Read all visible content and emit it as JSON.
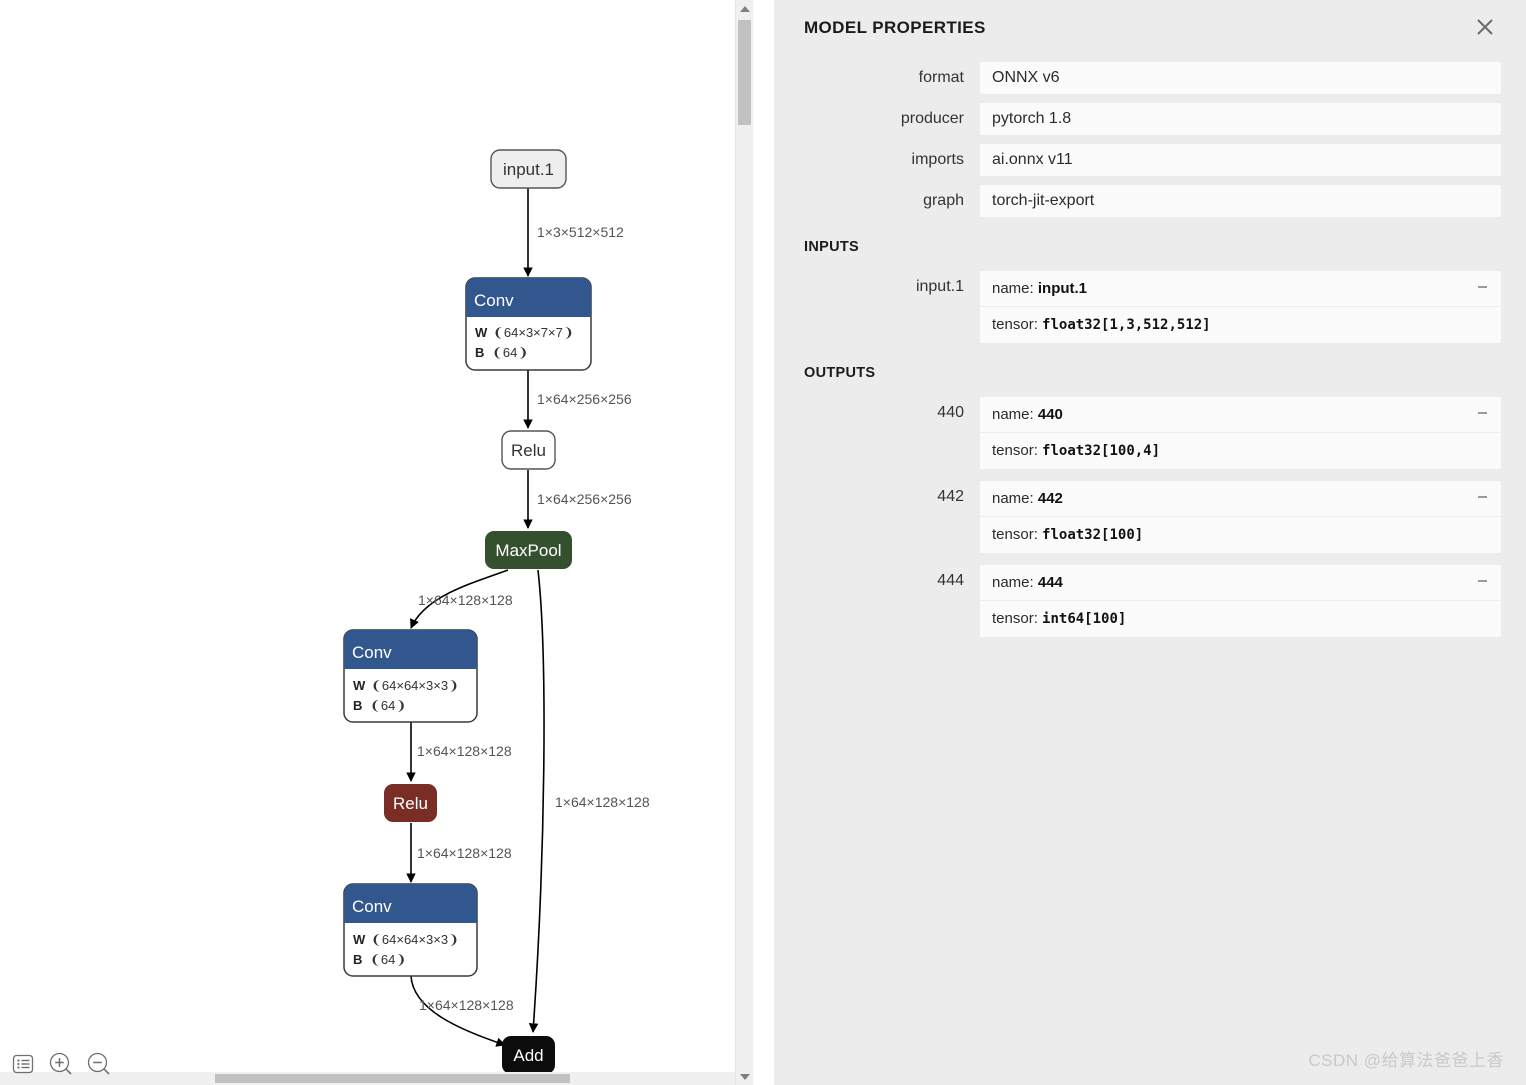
{
  "panel": {
    "title": "MODEL PROPERTIES",
    "close_icon": "close-icon",
    "fields": [
      {
        "label": "format",
        "value": "ONNX v6"
      },
      {
        "label": "producer",
        "value": "pytorch 1.8"
      },
      {
        "label": "imports",
        "value": "ai.onnx v11"
      },
      {
        "label": "graph",
        "value": "torch-jit-export"
      }
    ],
    "inputs_title": "INPUTS",
    "inputs": [
      {
        "label": "input.1",
        "name_prefix": "name: ",
        "name_value": "input.1",
        "tensor_prefix": "tensor: ",
        "tensor_value": "float32[1,3,512,512]"
      }
    ],
    "outputs_title": "OUTPUTS",
    "outputs": [
      {
        "label": "440",
        "name_prefix": "name: ",
        "name_value": "440",
        "tensor_prefix": "tensor: ",
        "tensor_value": "float32[100,4]"
      },
      {
        "label": "442",
        "name_prefix": "name: ",
        "name_value": "442",
        "tensor_prefix": "tensor: ",
        "tensor_value": "float32[100]"
      },
      {
        "label": "444",
        "name_prefix": "name: ",
        "name_value": "444",
        "tensor_prefix": "tensor: ",
        "tensor_value": "int64[100]"
      }
    ]
  },
  "graph": {
    "nodes": {
      "input1": {
        "label": "input.1",
        "type": "io"
      },
      "conv1": {
        "label": "Conv",
        "type": "op",
        "color": "#32578f",
        "attrs": [
          {
            "key": "W",
            "value": "❨64×3×7×7❩"
          },
          {
            "key": "B",
            "value": "❨64❩"
          }
        ]
      },
      "relu1": {
        "label": "Relu",
        "type": "plain"
      },
      "maxpool": {
        "label": "MaxPool",
        "type": "op-simple",
        "color": "#34502f"
      },
      "conv2": {
        "label": "Conv",
        "type": "op",
        "color": "#32578f",
        "attrs": [
          {
            "key": "W",
            "value": "❨64×64×3×3❩"
          },
          {
            "key": "B",
            "value": "❨64❩"
          }
        ]
      },
      "relu2": {
        "label": "Relu",
        "type": "op-simple",
        "color": "#7a2d25"
      },
      "conv3": {
        "label": "Conv",
        "type": "op",
        "color": "#32578f",
        "attrs": [
          {
            "key": "W",
            "value": "❨64×64×3×3❩"
          },
          {
            "key": "B",
            "value": "❨64❩"
          }
        ]
      },
      "add": {
        "label": "Add",
        "type": "op-simple",
        "color": "#0c0c0c"
      }
    },
    "edge_labels": {
      "input1_conv1": "1×3×512×512",
      "conv1_relu1": "1×64×256×256",
      "relu1_maxpool": "1×64×256×256",
      "maxpool_conv2": "1×64×128×128",
      "conv2_relu2": "1×64×128×128",
      "relu2_conv3": "1×64×128×128",
      "conv3_add": "1×64×128×128",
      "maxpool_add": "1×64×128×128"
    }
  },
  "toolbar": {
    "items": [
      {
        "icon": "list-icon",
        "name": "model-list-button"
      },
      {
        "icon": "zoom-in-icon",
        "name": "zoom-in-button"
      },
      {
        "icon": "zoom-out-icon",
        "name": "zoom-out-button"
      }
    ]
  },
  "watermark": {
    "text": "CSDN @给算法爸爸上香"
  }
}
